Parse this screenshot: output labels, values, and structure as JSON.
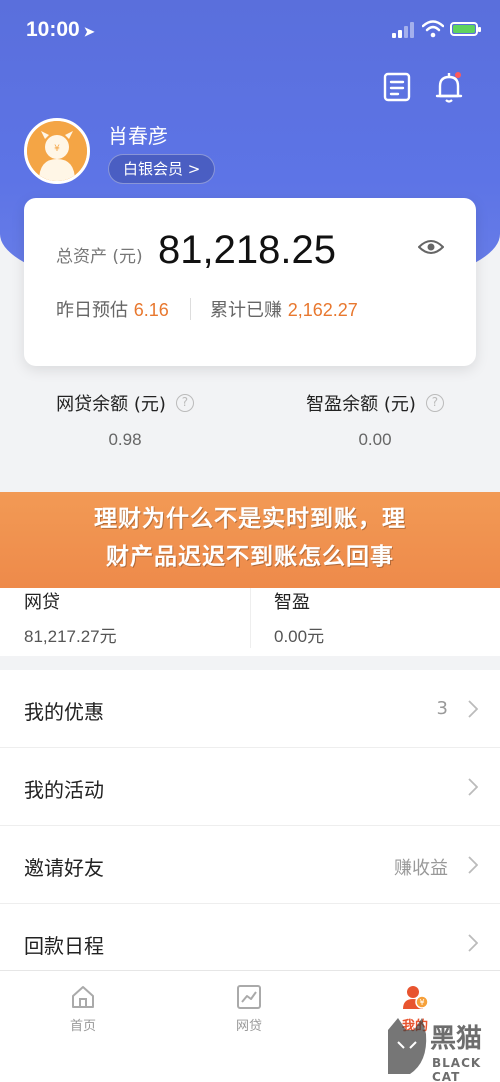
{
  "status_bar": {
    "time": "10:00"
  },
  "profile": {
    "name": "肖春彦",
    "member_level": "白银会员 >"
  },
  "asset_card": {
    "total_label": "总资产 (元)",
    "total_value": "81,218.25",
    "yesterday_label": "昨日预估",
    "yesterday_value": "6.16",
    "earned_label": "累计已赚",
    "earned_value": "2,162.27"
  },
  "balances": [
    {
      "label": "网贷余额 (元)",
      "value": "0.98"
    },
    {
      "label": "智盈余额 (元)",
      "value": "0.00"
    }
  ],
  "promo_banner": {
    "line1": "理财为什么不是实时到账，理",
    "line2": "财产品迟迟不到账怎么回事"
  },
  "products": [
    {
      "name": "网贷",
      "value": "81,217.27元"
    },
    {
      "name": "智盈",
      "value": "0.00元"
    }
  ],
  "menu": [
    {
      "label": "我的优惠",
      "right": "3"
    },
    {
      "label": "我的活动",
      "right": ""
    },
    {
      "label": "邀请好友",
      "right": "赚收益"
    },
    {
      "label": "回款日程",
      "right": ""
    }
  ],
  "tabs": [
    {
      "label": "首页",
      "icon": "home-icon"
    },
    {
      "label": "网贷",
      "icon": "chart-icon"
    },
    {
      "label": "我的",
      "icon": "user-icon"
    }
  ],
  "watermark": {
    "text": "黑猫",
    "sub": "BLACK CAT"
  },
  "colors": {
    "header": "#5d74e6",
    "accent_orange": "#e8782f",
    "active_tab": "#e8542f",
    "banner": "#ee8a4a"
  }
}
